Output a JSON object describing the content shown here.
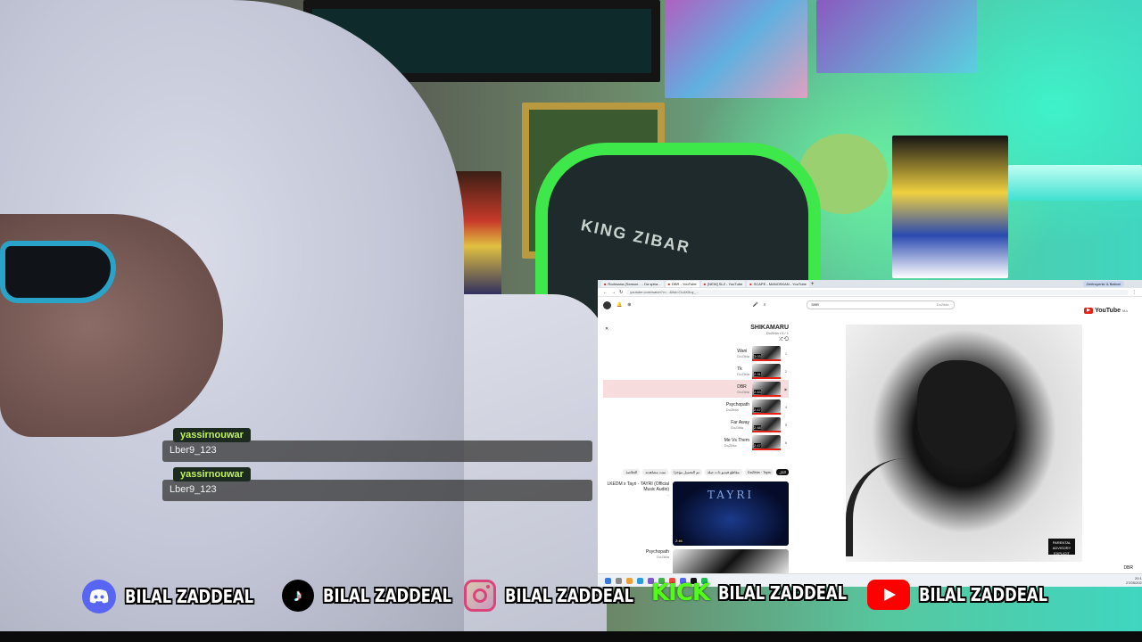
{
  "chat": [
    {
      "user": "yassirnouwar",
      "message": "Lber9_123"
    },
    {
      "user": "yassirnouwar",
      "message": "Lber9_123"
    }
  ],
  "background": {
    "chair_text": "KING ZIBAR"
  },
  "browser": {
    "tabs": [
      {
        "label": "Rocksana (Season... - Da sptra...",
        "active": false
      },
      {
        "label": "DBR - YouTube",
        "active": true
      },
      {
        "label": "[NEW] SLZ - YouTube",
        "active": false
      },
      {
        "label": "SCAPE - MANOSKAN - YouTube",
        "active": false
      }
    ],
    "profile_tab": "Zeetruyenkr & Baitoni",
    "url": "youtube.com/watch?v=...&list=OLAK5uy_...",
    "search_query": "DBR",
    "search_hint": "DoZibla",
    "yt_logo": "YouTube",
    "yt_logo_suffix": "MA",
    "playlist": {
      "title": "SHIKAMARU",
      "subtitle": "DoZibla • 6 / 1",
      "items": [
        {
          "title": "Wani",
          "artist": "DoZibla",
          "duration": "3:03",
          "index": "1",
          "selected": false
        },
        {
          "title": "Tk",
          "artist": "DoZibla",
          "duration": "2:31",
          "index": "2",
          "selected": false
        },
        {
          "title": "DBR",
          "artist": "DoZibla",
          "duration": "2:43",
          "index": "▶",
          "selected": true
        },
        {
          "title": "Psychopath",
          "artist": "DoZibla",
          "duration": "2:47",
          "index": "4",
          "selected": false
        },
        {
          "title": "Far Away",
          "artist": "DoZibla",
          "duration": "2:48",
          "index": "5",
          "selected": false
        },
        {
          "title": "Me Vs Them",
          "artist": "DoZibla",
          "duration": "2:47",
          "index": "6",
          "selected": false
        }
      ]
    },
    "chips": [
      {
        "label": "DoZibla · Topic",
        "on": false
      },
      {
        "label": "الكل",
        "on": true
      },
      {
        "label": "مقاطع فيديو ذات صلة",
        "on": false
      },
      {
        "label": "تم التحميل مؤخرًا",
        "on": false
      },
      {
        "label": "تمت مشاهدته",
        "on": false
      },
      {
        "label": "الخلاصة",
        "on": false
      }
    ],
    "recommendations": [
      {
        "title": "LKEDM x Tayri - TAYRI (Official Music Audio)",
        "meta": "...",
        "duration": "2:46",
        "thumb_title": "TAYRI"
      },
      {
        "title": "Psychopath",
        "meta": "DoZibla",
        "duration": "",
        "thumb_title": ""
      }
    ],
    "cover_label": "PARENTAL ADVISORY EXPLICIT CONTENT",
    "player_tag": "DBR",
    "clock": "20:14\n27/05/2024"
  },
  "socials": [
    {
      "platform": "discord",
      "icon": "discord-icon",
      "label": "BILAL ZADDEAL"
    },
    {
      "platform": "tiktok",
      "icon": "tiktok-icon",
      "label": "BILAL ZADDEAL"
    },
    {
      "platform": "instagram",
      "icon": "instagram-icon",
      "label": "BILAL ZADDEAL"
    },
    {
      "platform": "kick",
      "icon": "kick-icon",
      "icon_text": "KICK",
      "label": "BILAL ZADDEAL"
    },
    {
      "platform": "youtube",
      "icon": "youtube-icon",
      "label": "BILAL ZADDEAL"
    }
  ],
  "colors": {
    "chat_name": "#bff55a",
    "youtube_red": "#ff0000",
    "discord": "#5865f2",
    "kick": "#53fc18",
    "chair_accent": "#3ee84a"
  }
}
